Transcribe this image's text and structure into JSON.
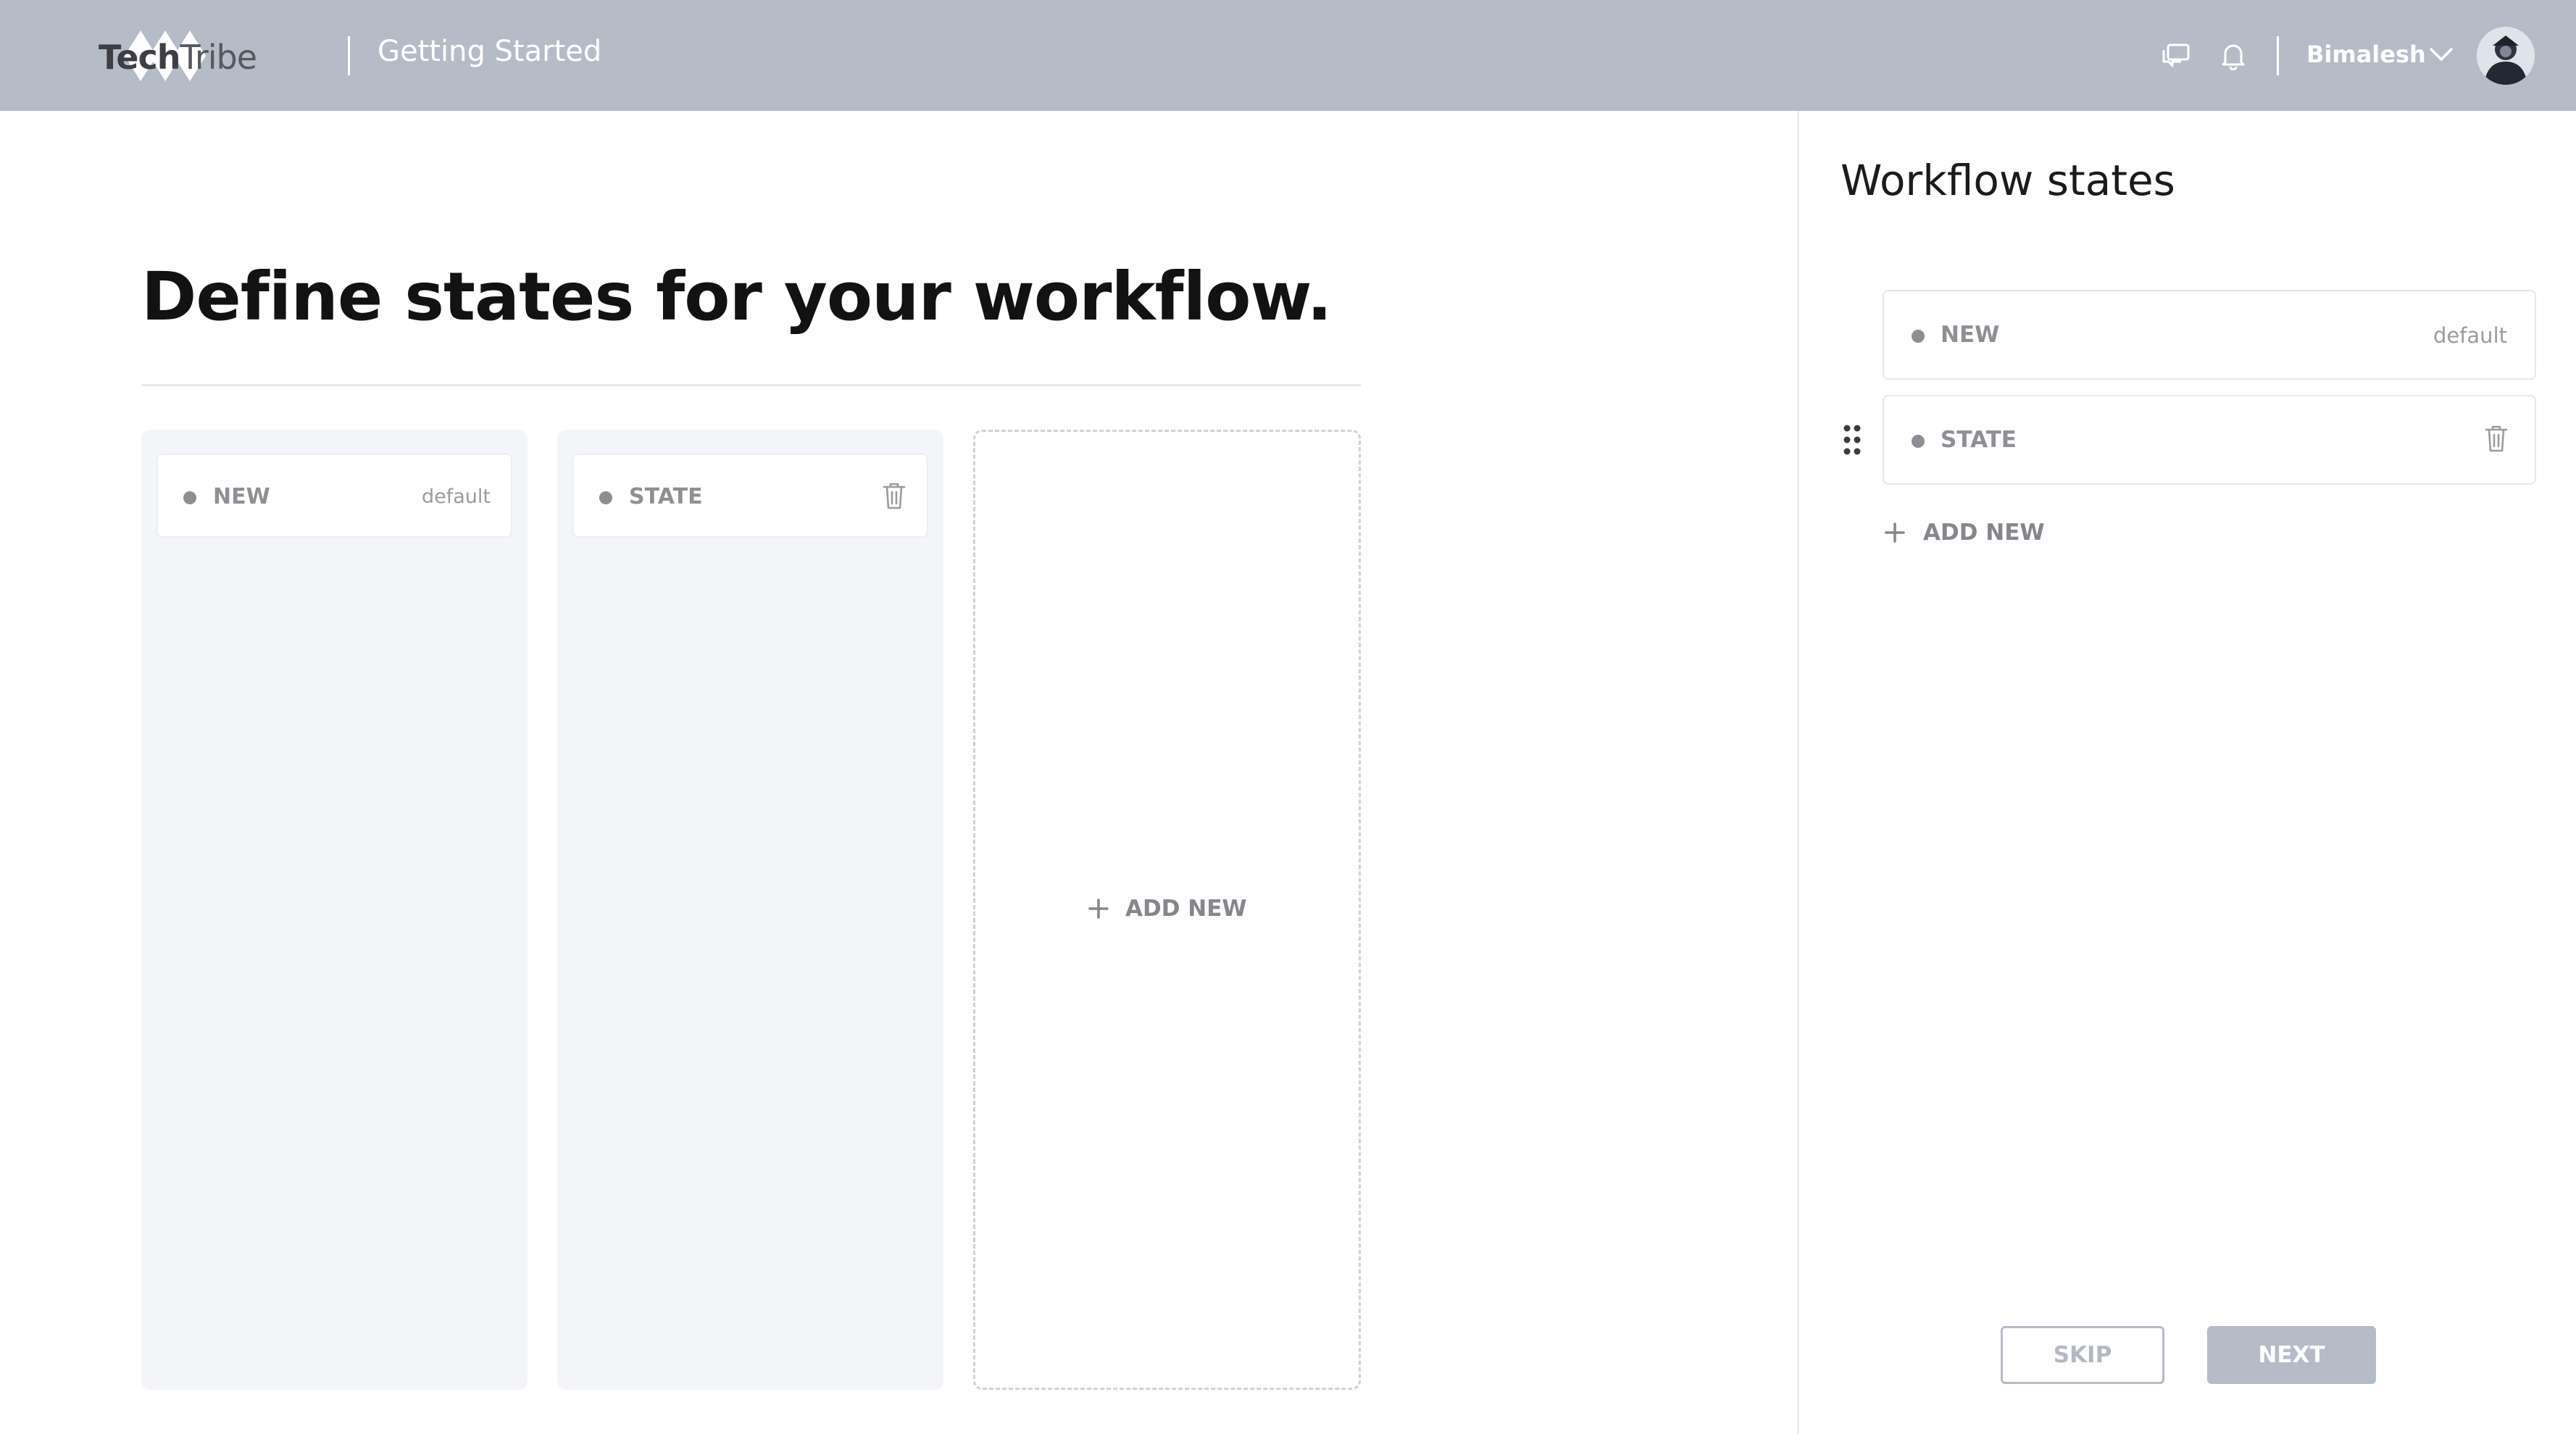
{
  "header": {
    "logo_part1": "Tech",
    "logo_part2": "Tribe",
    "title": "Getting Started",
    "username": "Bimalesh",
    "icons": [
      "chat-icon",
      "bell-icon",
      "chevron-down-icon",
      "avatar"
    ]
  },
  "main": {
    "heading": "Define states for your workflow.",
    "columns": [
      {
        "label": "NEW",
        "badge": "default"
      },
      {
        "label": "STATE",
        "icon": "trash-icon"
      }
    ],
    "add_new_label": "ADD NEW"
  },
  "panel": {
    "title": "Workflow states",
    "states": [
      {
        "label": "NEW",
        "badge": "default"
      },
      {
        "label": "STATE",
        "icon": "trash-icon"
      }
    ],
    "add_new_label": "ADD NEW",
    "skip_label": "SKIP",
    "next_label": "NEXT"
  },
  "colors": {
    "header_bg": "#b5bcc8",
    "column_bg": "#f3f5f8",
    "muted_text": "#8e9095"
  }
}
